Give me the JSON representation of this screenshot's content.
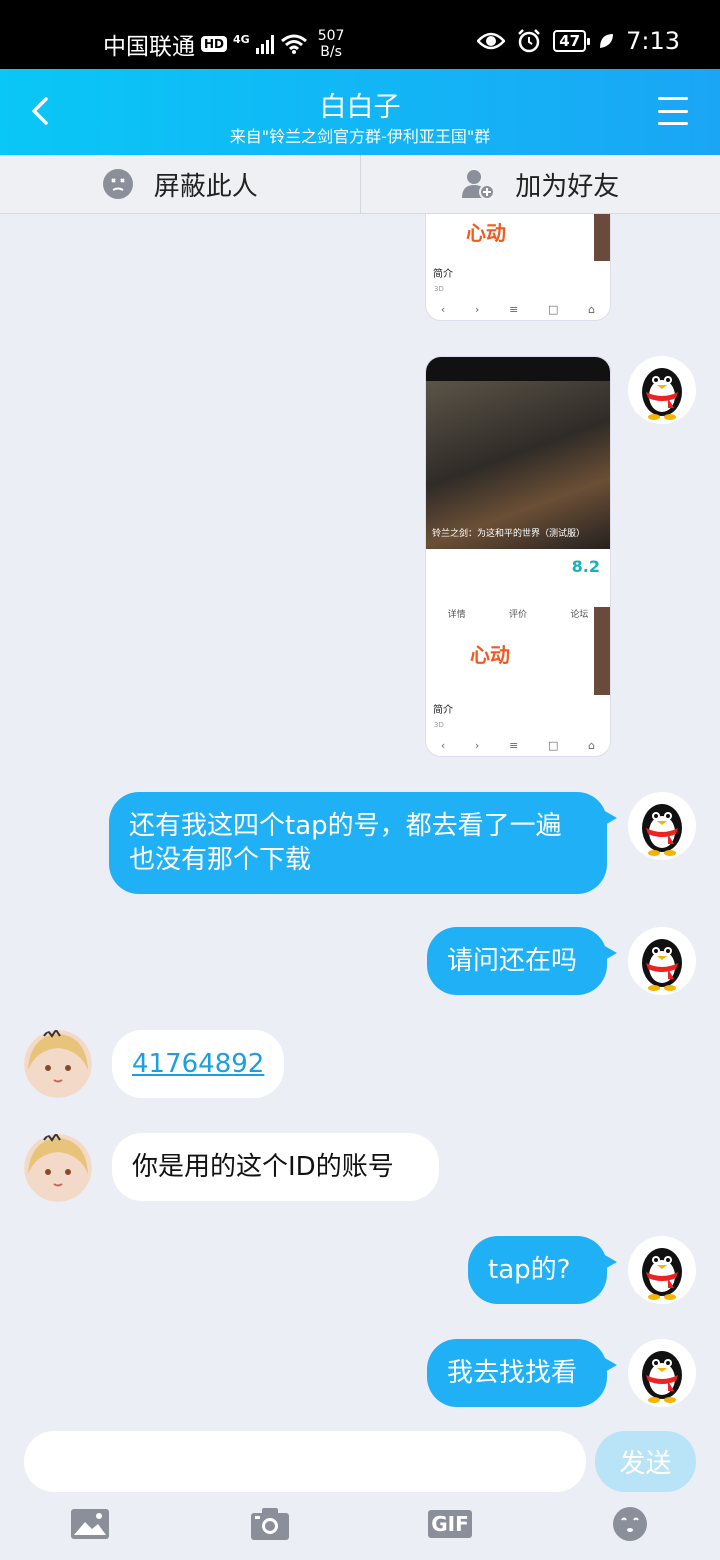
{
  "status_bar": {
    "carrier": "中国联通",
    "hd": "HD",
    "network": "4G",
    "speed_value": "507",
    "speed_unit": "B/s",
    "battery": "47",
    "time": "7:13"
  },
  "header": {
    "title": "白白子",
    "subtitle": "来自\"铃兰之剑官方群-伊利亚王国\"群"
  },
  "actions": {
    "block_label": "屏蔽此人",
    "add_friend_label": "加为好友"
  },
  "shared_screenshot": {
    "intro_label": "简介",
    "detail_tab": "详情",
    "review_tab": "评价",
    "forum_tab": "论坛",
    "game_title": "铃兰之剑：为这和平的世界（测试服）",
    "rating": "8.2",
    "logo_text": "心动",
    "tag": "3D"
  },
  "messages": [
    {
      "from": "me",
      "text": "还有我这四个tap的号，都去看了一遍也没有那个下载"
    },
    {
      "from": "me",
      "text": "请问还在吗"
    },
    {
      "from": "them",
      "text": "41764892"
    },
    {
      "from": "them",
      "text": "你是用的这个ID的账号"
    },
    {
      "from": "me",
      "text": "tap的?"
    },
    {
      "from": "me",
      "text": "我去找找看"
    }
  ],
  "input": {
    "placeholder": "",
    "send_label": "发送"
  },
  "toolbar": {
    "gif_label": "GIF"
  },
  "colors": {
    "header_start": "#09c7f6",
    "header_end": "#1aa6f5",
    "my_bubble": "#1fb0f6",
    "send_disabled": "#b9e4f8"
  }
}
